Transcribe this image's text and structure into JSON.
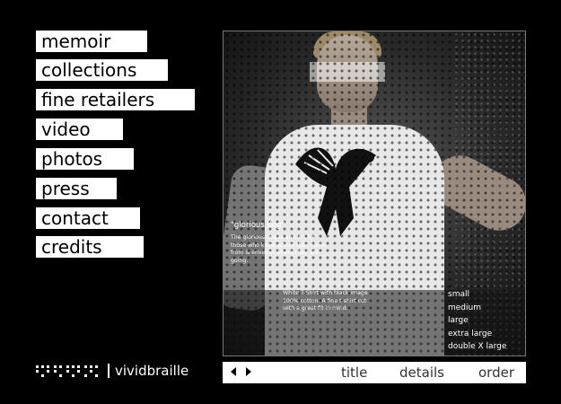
{
  "nav": {
    "items": [
      {
        "label": "memoir"
      },
      {
        "label": "collections"
      },
      {
        "label": "fine retailers"
      },
      {
        "label": "video"
      },
      {
        "label": "photos"
      },
      {
        "label": "press"
      },
      {
        "label": "contact"
      },
      {
        "label": "credits"
      }
    ]
  },
  "brand": {
    "name": "vividbraille"
  },
  "product": {
    "title": "\"glorious dog\"",
    "description": "The glorious dog is an icon for those who know where they came from & envision where they are going.",
    "details": "White T-Shirt with black image 100% cotton. A fine t-shirt cut with a great fit in mind.",
    "sizes": [
      "small",
      "medium",
      "large",
      "extra large",
      "double X large"
    ]
  },
  "bottom_bar": {
    "tabs": [
      {
        "label": "title"
      },
      {
        "label": "details"
      },
      {
        "label": "order"
      }
    ]
  },
  "colors": {
    "background": "#000000",
    "nav_bg": "#ffffff",
    "nav_text": "#000000"
  }
}
